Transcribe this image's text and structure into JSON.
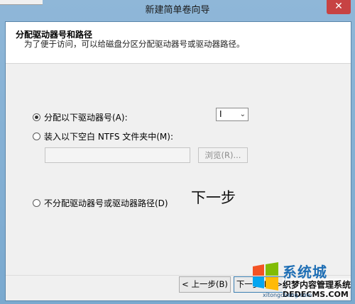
{
  "window": {
    "title": "新建简单卷向导",
    "close_glyph": "✕"
  },
  "header": {
    "title": "分配驱动器号和路径",
    "subtitle": "为了便于访问，可以给磁盘分区分配驱动器号或驱动器路径。"
  },
  "options": {
    "assign_letter": {
      "label": "分配以下驱动器号(A):",
      "checked": true
    },
    "mount_folder": {
      "label": "装入以下空白 NTFS 文件夹中(M):",
      "checked": false
    },
    "no_assign": {
      "label": "不分配驱动器号或驱动器路径(D)",
      "checked": false
    }
  },
  "drive_select": {
    "value": "I",
    "chevron": "⌄"
  },
  "path_input": {
    "value": ""
  },
  "browse_button": {
    "label": "浏览(R)..."
  },
  "annotation": {
    "text": "下一步"
  },
  "footer": {
    "back_label": "< 上一步(B)",
    "next_label": "下一步(N) >"
  },
  "watermark": {
    "logo_text": "系统城",
    "line1": "织梦内容管理系统",
    "line2": "DEDECMS.COM",
    "url_small": "xitongcheng.com"
  }
}
